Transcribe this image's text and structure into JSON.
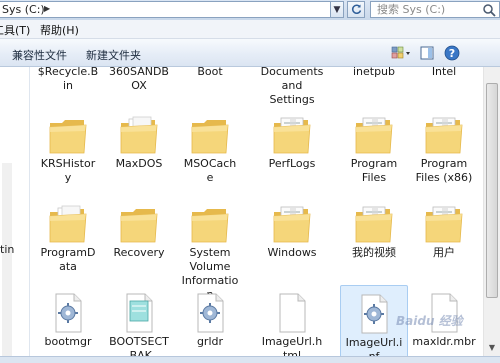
{
  "address": {
    "path": "Sys (C:)"
  },
  "search": {
    "placeholder": "搜索 Sys (C:)"
  },
  "menu": {
    "tools": "工具(T)",
    "help": "帮助(H)"
  },
  "toolbar": {
    "compat_files": "兼容性文件",
    "new_folder": "新建文件夹"
  },
  "nav": {
    "item_partial": "tin"
  },
  "files": [
    {
      "name": "$Recycle.Bin",
      "lines": [
        "$Recycle.B",
        "in"
      ],
      "type": "folder-partial"
    },
    {
      "name": "360SANDBOX",
      "lines": [
        "360SANDB",
        "OX"
      ],
      "type": "folder-partial"
    },
    {
      "name": "Boot",
      "lines": [
        "Boot"
      ],
      "type": "folder-partial"
    },
    {
      "name": "Documents and Settings",
      "lines": [
        "Documents",
        "and",
        "Settings"
      ],
      "type": "folder-partial"
    },
    {
      "name": "inetpub",
      "lines": [
        "inetpub"
      ],
      "type": "folder-partial"
    },
    {
      "name": "Intel",
      "lines": [
        "Intel"
      ],
      "type": "folder-partial"
    },
    {
      "name": "KRSHistory",
      "lines": [
        "KRSHistor",
        "y"
      ],
      "type": "folder"
    },
    {
      "name": "MaxDOS",
      "lines": [
        "MaxDOS"
      ],
      "type": "folder-white"
    },
    {
      "name": "MSOCache",
      "lines": [
        "MSOCach",
        "e"
      ],
      "type": "folder"
    },
    {
      "name": "PerfLogs",
      "lines": [
        "PerfLogs"
      ],
      "type": "folder-doc"
    },
    {
      "name": "Program Files",
      "lines": [
        "Program",
        "Files"
      ],
      "type": "folder-doc"
    },
    {
      "name": "Program Files (x86)",
      "lines": [
        "Program",
        "Files (x86)"
      ],
      "type": "folder-doc"
    },
    {
      "name": "ProgramData",
      "lines": [
        "ProgramD",
        "ata"
      ],
      "type": "folder-white"
    },
    {
      "name": "Recovery",
      "lines": [
        "Recovery"
      ],
      "type": "folder"
    },
    {
      "name": "System Volume Information",
      "lines": [
        "System",
        "Volume",
        "Informatio",
        "n"
      ],
      "type": "folder"
    },
    {
      "name": "Windows",
      "lines": [
        "Windows"
      ],
      "type": "folder-doc"
    },
    {
      "name": "我的视频",
      "lines": [
        "我的视频"
      ],
      "type": "folder-doc"
    },
    {
      "name": "用户",
      "lines": [
        "用户"
      ],
      "type": "folder-doc"
    },
    {
      "name": "bootmgr",
      "lines": [
        "bootmgr"
      ],
      "type": "file-gear"
    },
    {
      "name": "BOOTSECT.BAK",
      "lines": [
        "BOOTSECT",
        ".BAK"
      ],
      "type": "file-bak"
    },
    {
      "name": "grldr",
      "lines": [
        "grldr"
      ],
      "type": "file-gear"
    },
    {
      "name": "ImageUrl.html",
      "lines": [
        "ImageUrl.h",
        "tml"
      ],
      "type": "file-blank"
    },
    {
      "name": "ImageUrl.inf",
      "lines": [
        "ImageUrl.i",
        "nf"
      ],
      "type": "file-gear"
    },
    {
      "name": "maxldr.mbr",
      "lines": [
        "maxldr.mbr"
      ],
      "type": "file-blank"
    }
  ],
  "watermark": "Baidu 经验",
  "colors": {
    "folder": "#f5d67a",
    "folder_dark": "#e6b94c",
    "selection": "#dfeefd"
  }
}
